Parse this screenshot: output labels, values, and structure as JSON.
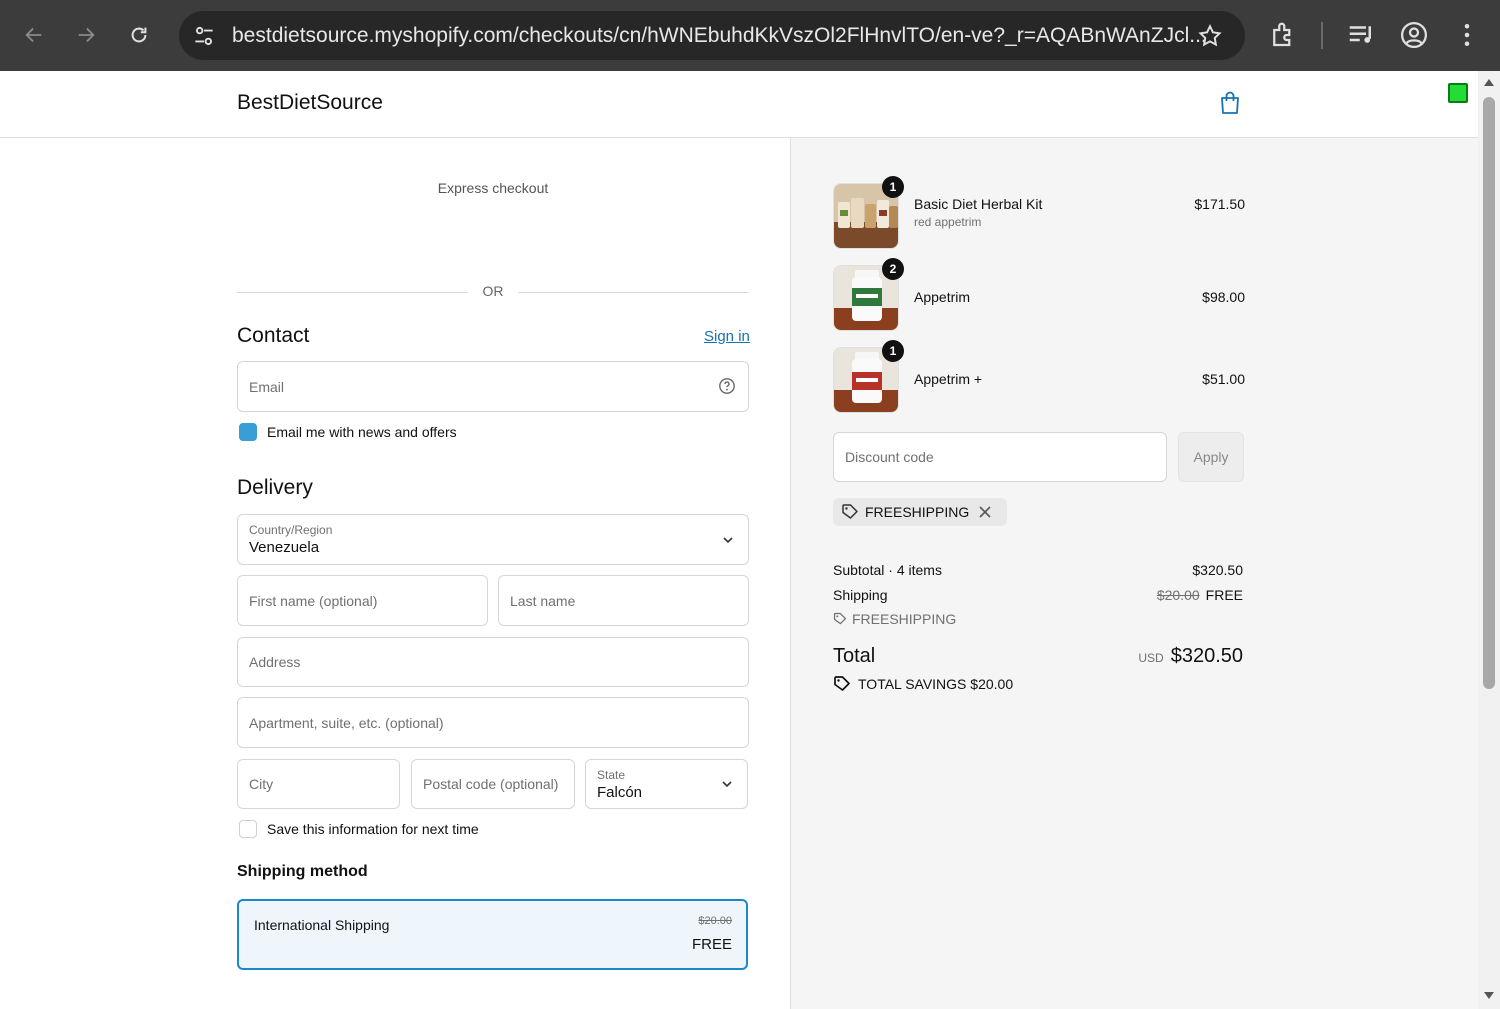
{
  "browser": {
    "url": "bestdietsource.myshopify.com/checkouts/cn/hWNEbuhdKkVszOl2FlHnvlTO/en-ve?_r=AQABnWAnZJcl..."
  },
  "header": {
    "store_name": "BestDietSource"
  },
  "express": {
    "title": "Express checkout",
    "or_label": "OR"
  },
  "contact": {
    "heading": "Contact",
    "signin": "Sign in",
    "email_placeholder": "Email",
    "newsletter_label": "Email me with news and offers",
    "newsletter_checked": true
  },
  "delivery": {
    "heading": "Delivery",
    "country_label": "Country/Region",
    "country_value": "Venezuela",
    "first_name_placeholder": "First name (optional)",
    "last_name_placeholder": "Last name",
    "address_placeholder": "Address",
    "apartment_placeholder": "Apartment, suite, etc. (optional)",
    "city_placeholder": "City",
    "postal_placeholder": "Postal code (optional)",
    "state_label": "State",
    "state_value": "Falcón",
    "save_info_label": "Save this information for next time"
  },
  "shipping_method": {
    "heading": "Shipping method",
    "option_name": "International Shipping",
    "old_price": "$20.00",
    "price": "FREE"
  },
  "cart": {
    "items": [
      {
        "name": "Basic Diet Herbal Kit",
        "variant": "red appetrim",
        "qty": "1",
        "price": "$171.50"
      },
      {
        "name": "Appetrim",
        "variant": "",
        "qty": "2",
        "price": "$98.00"
      },
      {
        "name": "Appetrim +",
        "variant": "",
        "qty": "1",
        "price": "$51.00"
      }
    ],
    "discount_placeholder": "Discount code",
    "apply_label": "Apply",
    "applied_code": "FREESHIPPING"
  },
  "summary": {
    "subtotal_label": "Subtotal · 4 items",
    "subtotal_value": "$320.50",
    "shipping_label": "Shipping",
    "shipping_old": "$20.00",
    "shipping_value": "FREE",
    "shipping_code": "FREESHIPPING",
    "total_label": "Total",
    "currency": "USD",
    "total_value": "$320.50",
    "savings_label": "TOTAL SAVINGS",
    "savings_value": "$20.00"
  },
  "colors": {
    "accent": "#1773b0",
    "selected_border": "#1c88c7",
    "checkbox": "#3a9ed6"
  }
}
